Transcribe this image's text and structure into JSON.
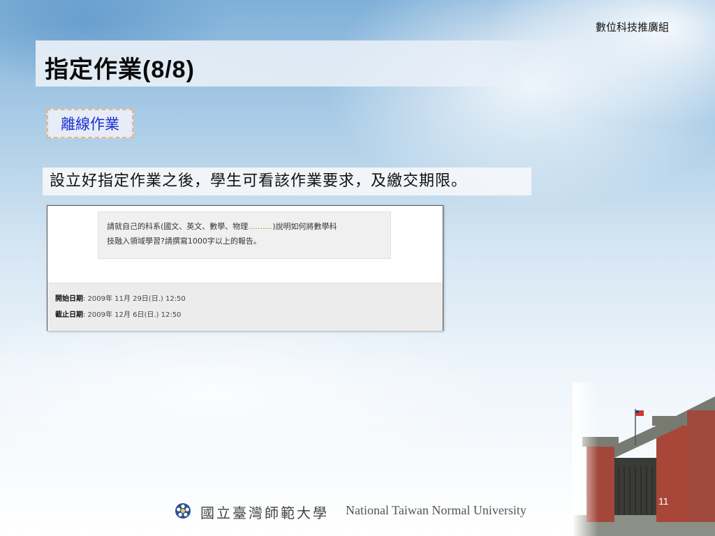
{
  "header": {
    "group_label": "數位科技推廣組",
    "title": "指定作業(8/8)"
  },
  "tag": {
    "label": "離線作業"
  },
  "description": "設立好指定作業之後，學生可看該作業要求，及繳交期限。",
  "screenshot": {
    "requirement_line1_a": "請就自己的科系(國文、英文、數學、物理",
    "requirement_line1_dots": "..........",
    "requirement_line1_b": ")說明如何將數學科",
    "requirement_line2": "技融入領域學習?請撰寫1000字以上的報告。",
    "start_label": "開始日期",
    "start_value": ": 2009年 11月 29日(日.) 12:50",
    "end_label": "截止日期",
    "end_value": ": 2009年 12月 6日(日.) 12:50"
  },
  "footer": {
    "university_zh": "國立臺灣師範大學",
    "university_en": "National Taiwan Normal University",
    "page_number": "11"
  },
  "colors": {
    "title_text": "#0b0b0b",
    "tag_text": "#1a2fd0",
    "tag_border": "#f3b27a",
    "tag_bg": "#e6ecf8"
  },
  "icons": {
    "footer_logo": "university-emblem-icon",
    "gate_photo": "campus-gate-image"
  }
}
